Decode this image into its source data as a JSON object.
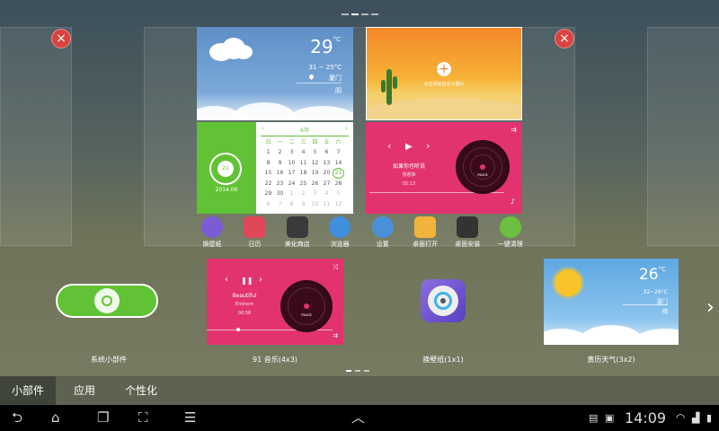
{
  "home_preview": {
    "weather_widget": {
      "temperature": "29",
      "unit": "°C",
      "range": "31 ~ 25°C",
      "location": "厦门",
      "condition": "阴"
    },
    "photo_widget": {
      "hint": "点击添加自定义图片"
    },
    "calendar_widget": {
      "day": "21",
      "year_month": "2014.06",
      "month_label": "6月",
      "weekdays": [
        "日",
        "一",
        "二",
        "三",
        "四",
        "五",
        "六"
      ],
      "days": [
        "1",
        "2",
        "3",
        "4",
        "5",
        "6",
        "7",
        "8",
        "9",
        "10",
        "11",
        "12",
        "13",
        "14",
        "15",
        "16",
        "17",
        "18",
        "19",
        "20",
        "21",
        "22",
        "23",
        "24",
        "25",
        "26",
        "27",
        "28",
        "29",
        "30",
        "1",
        "2",
        "3",
        "4",
        "5",
        "6",
        "7",
        "8",
        "9",
        "10",
        "11",
        "12"
      ],
      "today": "21"
    },
    "music_widget": {
      "song": "如果你也听说",
      "artist": "张惠妹",
      "time": "05:13",
      "disc_label": "music"
    },
    "dock": [
      {
        "label": "换壁纸",
        "icon": "wallpaper-icon",
        "color": "#7b5cd6"
      },
      {
        "label": "日历",
        "icon": "calendar-icon",
        "color": "#e0475b"
      },
      {
        "label": "美化商店",
        "icon": "tuxedo-icon",
        "color": "#3a3a3a"
      },
      {
        "label": "浏览器",
        "icon": "planet-icon",
        "color": "#3f8fdc"
      },
      {
        "label": "设置",
        "icon": "gear-icon",
        "color": "#4a90d9"
      },
      {
        "label": "桌面打开",
        "icon": "folder-icon",
        "color": "#f2b33a"
      },
      {
        "label": "桌面安装",
        "icon": "speaker-icon",
        "color": "#333333"
      },
      {
        "label": "一键清理",
        "icon": "clean-icon",
        "color": "#6bc042"
      }
    ],
    "close_symbol": "×"
  },
  "widget_tray": [
    {
      "label": "系统小部件"
    },
    {
      "label": "91 音乐(4x3)",
      "song": "Beautiful",
      "artist": "Eminem",
      "time": "00:58",
      "disc_label": "music"
    },
    {
      "label": "换壁纸(1x1)"
    },
    {
      "label": "黄历天气(3x2)",
      "temperature": "26",
      "unit": "°C",
      "range": "32~26°C",
      "location": "厦门",
      "condition": "晴"
    }
  ],
  "tabs": [
    {
      "label": "小部件",
      "active": true
    },
    {
      "label": "应用",
      "active": false
    },
    {
      "label": "个性化",
      "active": false
    }
  ],
  "status_bar": {
    "time": "14:09"
  },
  "colors": {
    "music_pink": "#e23370",
    "calendar_green": "#62c236",
    "close_red": "#d9433f"
  }
}
